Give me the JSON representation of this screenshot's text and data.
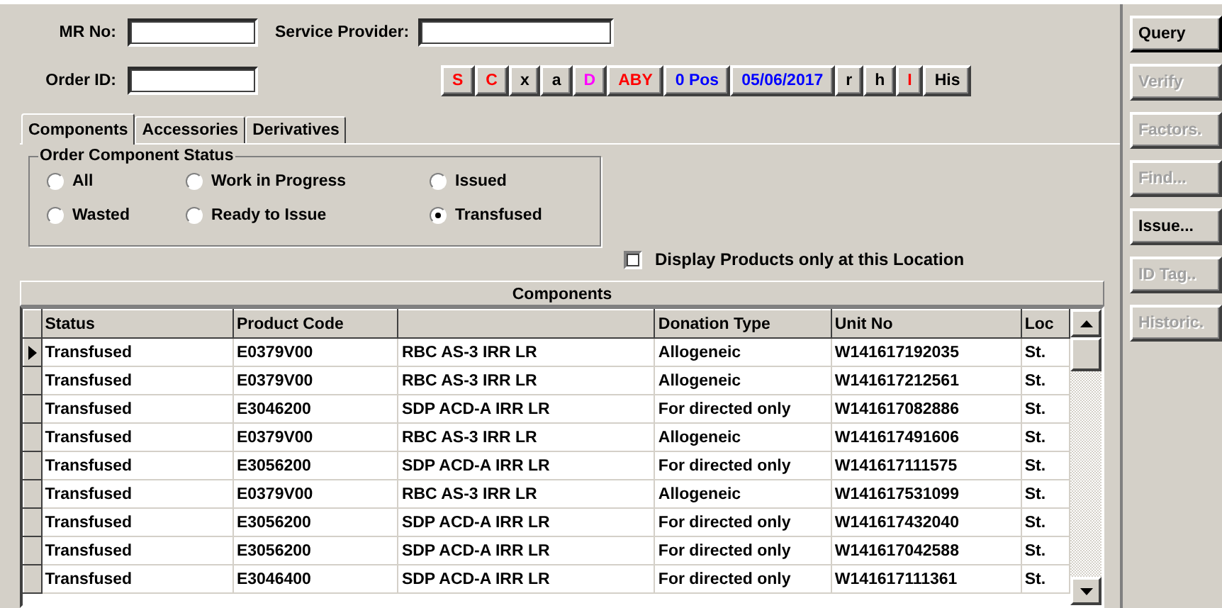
{
  "search_fields": [
    {
      "label": "MR No:"
    },
    {
      "label": "Service Provider:"
    },
    {
      "label": "Order ID:"
    }
  ],
  "flag_buttons": [
    {
      "label": "S",
      "color": "#ff0000"
    },
    {
      "label": "C",
      "color": "#ff0000"
    },
    {
      "label": "x",
      "color": "#000000"
    },
    {
      "label": "a",
      "color": "#000000"
    },
    {
      "label": "D",
      "color": "#ff00ff"
    },
    {
      "label": "ABY",
      "color": "#ff0000"
    },
    {
      "label": "0 Pos",
      "color": "#0000ff"
    },
    {
      "label": "05/06/2017",
      "color": "#0000ff"
    },
    {
      "label": "r",
      "color": "#000000"
    },
    {
      "label": "h",
      "color": "#000000"
    },
    {
      "label": "I",
      "color": "#ff0000"
    },
    {
      "label": "His",
      "color": "#000000"
    }
  ],
  "tabs": [
    {
      "label": "Components",
      "selected": true
    },
    {
      "label": "Accessories",
      "selected": false
    },
    {
      "label": "Derivatives",
      "selected": false
    }
  ],
  "status_group": {
    "title": "Order Component Status",
    "options": [
      {
        "label": "All",
        "selected": false
      },
      {
        "label": "Work in Progress",
        "selected": false
      },
      {
        "label": "Issued",
        "selected": false
      },
      {
        "label": "Wasted",
        "selected": false
      },
      {
        "label": "Ready to Issue",
        "selected": false
      },
      {
        "label": "Transfused",
        "selected": true
      }
    ]
  },
  "location_filter": {
    "label": "Display Products only at this Location",
    "checked": false
  },
  "table": {
    "title": "Components",
    "columns": [
      "Status",
      "Product Code",
      null,
      "Donation Type",
      "Unit No",
      "Loc"
    ],
    "rows": [
      {
        "current": true,
        "cells": [
          "Transfused",
          "E0379V00",
          "RBC AS-3 IRR LR",
          "Allogeneic",
          "W141617192035",
          "St."
        ]
      },
      {
        "current": false,
        "cells": [
          "Transfused",
          "E0379V00",
          "RBC AS-3 IRR LR",
          "Allogeneic",
          "W141617212561",
          "St."
        ]
      },
      {
        "current": false,
        "cells": [
          "Transfused",
          "E3046200",
          "SDP ACD-A IRR LR",
          "For directed only",
          "W141617082886",
          "St."
        ]
      },
      {
        "current": false,
        "cells": [
          "Transfused",
          "E0379V00",
          "RBC AS-3 IRR LR",
          "Allogeneic",
          "W141617491606",
          "St."
        ]
      },
      {
        "current": false,
        "cells": [
          "Transfused",
          "E3056200",
          "SDP ACD-A IRR LR",
          "For directed only",
          "W141617111575",
          "St."
        ]
      },
      {
        "current": false,
        "cells": [
          "Transfused",
          "E0379V00",
          "RBC AS-3 IRR LR",
          "Allogeneic",
          "W141617531099",
          "St."
        ]
      },
      {
        "current": false,
        "cells": [
          "Transfused",
          "E3056200",
          "SDP ACD-A IRR LR",
          "For directed only",
          "W141617432040",
          "St."
        ]
      },
      {
        "current": false,
        "cells": [
          "Transfused",
          "E3056200",
          "SDP ACD-A IRR LR",
          "For directed only",
          "W141617042588",
          "St."
        ]
      },
      {
        "current": false,
        "cells": [
          "Transfused",
          "E3046400",
          "SDP ACD-A IRR LR",
          "For directed only",
          "W141617111361",
          "St."
        ]
      }
    ]
  },
  "side_buttons": [
    {
      "label": "Query",
      "disabled": false
    },
    {
      "label": "Verify",
      "disabled": true
    },
    {
      "label": "Factors.",
      "disabled": true
    },
    {
      "label": "Find...",
      "disabled": true
    },
    {
      "label": "Issue...",
      "disabled": false
    },
    {
      "label": "ID Tag..",
      "disabled": true
    },
    {
      "label": "Historic.",
      "disabled": true
    }
  ]
}
